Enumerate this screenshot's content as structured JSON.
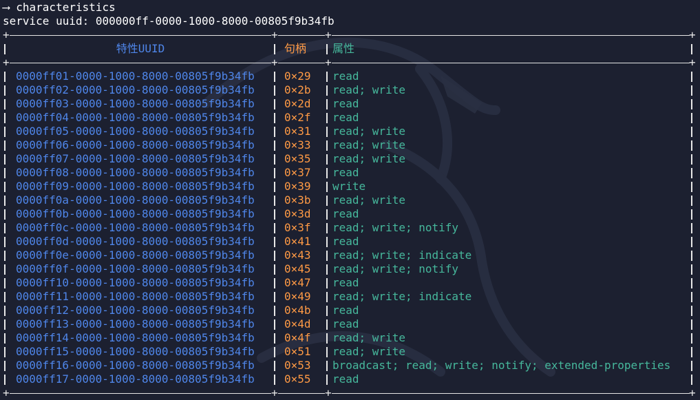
{
  "terminal": {
    "command_line": "⟶ characteristics",
    "service_line": "service uuid: 000000ff-0000-1000-8000-00805f9b34fb"
  },
  "table": {
    "headers": {
      "uuid": "特性UUID",
      "handle": "句柄",
      "properties": "属性"
    },
    "rows": [
      {
        "uuid": "0000ff01-0000-1000-8000-00805f9b34fb",
        "handle": "0×29",
        "properties": "read"
      },
      {
        "uuid": "0000ff02-0000-1000-8000-00805f9b34fb",
        "handle": "0×2b",
        "properties": "read; write"
      },
      {
        "uuid": "0000ff03-0000-1000-8000-00805f9b34fb",
        "handle": "0×2d",
        "properties": "read"
      },
      {
        "uuid": "0000ff04-0000-1000-8000-00805f9b34fb",
        "handle": "0×2f",
        "properties": "read"
      },
      {
        "uuid": "0000ff05-0000-1000-8000-00805f9b34fb",
        "handle": "0×31",
        "properties": "read; write"
      },
      {
        "uuid": "0000ff06-0000-1000-8000-00805f9b34fb",
        "handle": "0×33",
        "properties": "read; write"
      },
      {
        "uuid": "0000ff07-0000-1000-8000-00805f9b34fb",
        "handle": "0×35",
        "properties": "read; write"
      },
      {
        "uuid": "0000ff08-0000-1000-8000-00805f9b34fb",
        "handle": "0×37",
        "properties": "read"
      },
      {
        "uuid": "0000ff09-0000-1000-8000-00805f9b34fb",
        "handle": "0×39",
        "properties": "write"
      },
      {
        "uuid": "0000ff0a-0000-1000-8000-00805f9b34fb",
        "handle": "0×3b",
        "properties": "read; write"
      },
      {
        "uuid": "0000ff0b-0000-1000-8000-00805f9b34fb",
        "handle": "0×3d",
        "properties": "read"
      },
      {
        "uuid": "0000ff0c-0000-1000-8000-00805f9b34fb",
        "handle": "0×3f",
        "properties": "read; write; notify"
      },
      {
        "uuid": "0000ff0d-0000-1000-8000-00805f9b34fb",
        "handle": "0×41",
        "properties": "read"
      },
      {
        "uuid": "0000ff0e-0000-1000-8000-00805f9b34fb",
        "handle": "0×43",
        "properties": "read; write; indicate"
      },
      {
        "uuid": "0000ff0f-0000-1000-8000-00805f9b34fb",
        "handle": "0×45",
        "properties": "read; write; notify"
      },
      {
        "uuid": "0000ff10-0000-1000-8000-00805f9b34fb",
        "handle": "0×47",
        "properties": "read"
      },
      {
        "uuid": "0000ff11-0000-1000-8000-00805f9b34fb",
        "handle": "0×49",
        "properties": "read; write; indicate"
      },
      {
        "uuid": "0000ff12-0000-1000-8000-00805f9b34fb",
        "handle": "0×4b",
        "properties": "read"
      },
      {
        "uuid": "0000ff13-0000-1000-8000-00805f9b34fb",
        "handle": "0×4d",
        "properties": "read"
      },
      {
        "uuid": "0000ff14-0000-1000-8000-00805f9b34fb",
        "handle": "0×4f",
        "properties": "read; write"
      },
      {
        "uuid": "0000ff15-0000-1000-8000-00805f9b34fb",
        "handle": "0×51",
        "properties": "read; write"
      },
      {
        "uuid": "0000ff16-0000-1000-8000-00805f9b34fb",
        "handle": "0×53",
        "properties": "broadcast; read; write; notify; extended-properties"
      },
      {
        "uuid": "0000ff17-0000-1000-8000-00805f9b34fb",
        "handle": "0×55",
        "properties": "read"
      }
    ]
  },
  "colors": {
    "background": "#1c2030",
    "uuid": "#4f86ea",
    "handle": "#ff9a45",
    "properties": "#46b89c",
    "text": "#ffffff"
  },
  "background_art": "kali-dragon-watermark"
}
